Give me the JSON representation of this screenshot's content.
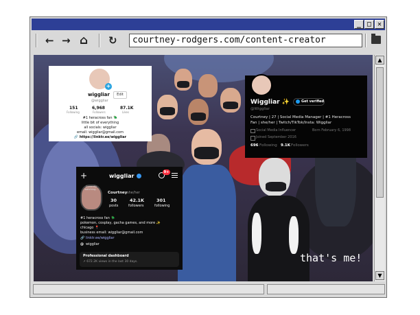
{
  "browser": {
    "minimize_glyph": "_",
    "maximize_glyph": "□",
    "close_glyph": "✕",
    "back_glyph": "←",
    "forward_glyph": "→",
    "home_glyph": "⌂",
    "reload_glyph": "↻",
    "url": "courtney-rodgers.com/content-creator",
    "scroll_up_glyph": "▲",
    "scroll_down_glyph": "▼",
    "titlebar_color": "#2d3f96"
  },
  "tiktok": {
    "username": "wiggliar",
    "handle": "@wiggliar",
    "edit_label": "Edit",
    "stats": [
      {
        "value": "151",
        "label": "Following"
      },
      {
        "value": "6,968",
        "label": "Followers"
      },
      {
        "value": "87.1K",
        "label": "Likes"
      }
    ],
    "bio": [
      "#1 heracross fan 🪲",
      "little bit of everything",
      "all socials: wiggliar",
      "email: wiggliar@gmail.com"
    ],
    "link": "🔗 https://linktr.ee/wiggliar"
  },
  "twitter": {
    "name": "Wiggliar ✨",
    "verify_label": "Get verified",
    "handle": "@Wiggliar",
    "bio": [
      "Courtney | 27 | Social Media Manager | #1 Heracross",
      "Fan | she/her | Twitch/TikTok/Insta: Wiggliar"
    ],
    "category": "Social Media Influencer",
    "born": "Born February 6, 1998",
    "joined": "Joined September 2016",
    "following_count": "696",
    "following_label": "Following",
    "followers_count": "9.1K",
    "followers_label": "Followers"
  },
  "instagram": {
    "username": "wiggliar",
    "notif_badge": "9+",
    "currently_label": "Currently watching...",
    "name": "Courtney",
    "pronouns": "she/her",
    "stats": [
      {
        "value": "30",
        "label": "posts"
      },
      {
        "value": "42.1K",
        "label": "followers"
      },
      {
        "value": "301",
        "label": "following"
      }
    ],
    "bio": [
      "#1 heracross fan 🪲",
      "pokemon, cosplay, gacha games, and more ✨",
      "chicago 📍",
      "business email: wiggliar@gmail.com"
    ],
    "link": "linktr.ee/wiggliar",
    "threads": "wiggliar",
    "dashboard_title": "Professional dashboard",
    "dashboard_sub": "↗ 672.2K views in the last 30 days."
  },
  "caption": "that's me!"
}
